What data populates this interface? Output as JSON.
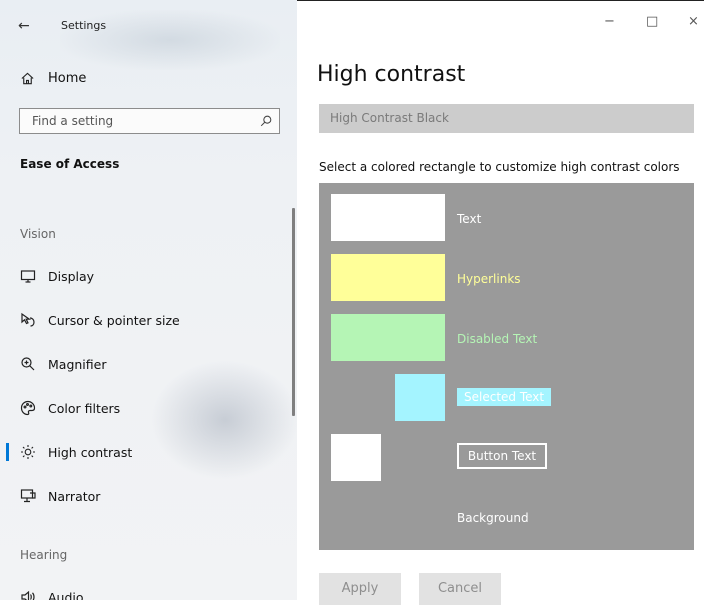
{
  "window": {
    "title": "Settings",
    "controls": {
      "minimize": "−",
      "maximize": "□",
      "close": "×"
    }
  },
  "sidebar": {
    "back_glyph": "←",
    "home_label": "Home",
    "search": {
      "placeholder": "Find a setting",
      "value": ""
    },
    "section_title": "Ease of Access",
    "groups": {
      "vision": "Vision",
      "hearing": "Hearing"
    },
    "items": [
      {
        "label": "Display",
        "icon": "display-icon",
        "active": false
      },
      {
        "label": "Cursor & pointer size",
        "icon": "cursor-icon",
        "active": false
      },
      {
        "label": "Magnifier",
        "icon": "magnifier-icon",
        "active": false
      },
      {
        "label": "Color filters",
        "icon": "color-filters-icon",
        "active": false
      },
      {
        "label": "High contrast",
        "icon": "sun-icon",
        "active": true
      },
      {
        "label": "Narrator",
        "icon": "narrator-icon",
        "active": false
      },
      {
        "label": "Audio",
        "icon": "speaker-icon",
        "active": false
      }
    ]
  },
  "main": {
    "title": "High contrast",
    "theme": {
      "selected": "High Contrast Black"
    },
    "instruction": "Select a colored rectangle to customize high contrast colors",
    "colors": [
      {
        "label": "Text",
        "color": "#ffffff"
      },
      {
        "label": "Hyperlinks",
        "color": "#ffff99"
      },
      {
        "label": "Disabled Text",
        "color": "#b5f5b5"
      },
      {
        "label": "Selected Text",
        "color": "#a4f4ff"
      },
      {
        "label": "Button Text",
        "color": "#ffffff"
      },
      {
        "label": "Background",
        "color": "#9a9a9a"
      }
    ],
    "apply_label": "Apply",
    "cancel_label": "Cancel"
  },
  "colors": {
    "accent": "#0078d7",
    "panel_bg": "#9a9a9a",
    "hyperlink_text": "#ffff99",
    "disabled_text": "#b5f5b5",
    "selected_bg": "#a4f4ff"
  }
}
